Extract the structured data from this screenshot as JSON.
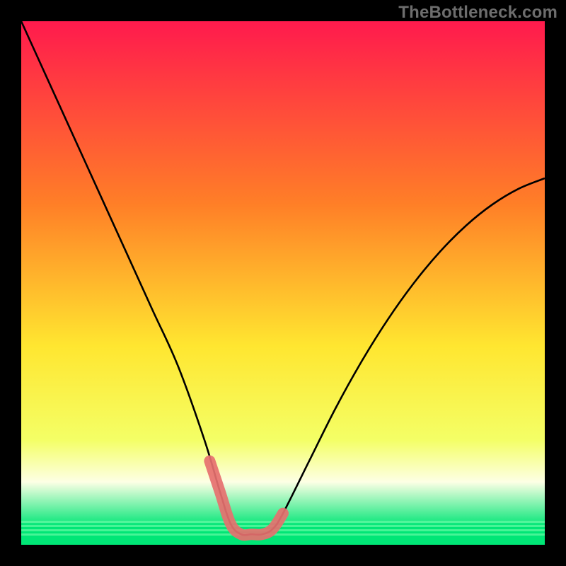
{
  "watermark": "TheBottleneck.com",
  "colors": {
    "frame": "#000000",
    "grad_top": "#ff1a4d",
    "grad_mid_upper": "#ff7f27",
    "grad_mid": "#ffe630",
    "grad_lower": "#f4ff66",
    "grad_bottom_band": "#fdffe5",
    "grad_green": "#00e676",
    "curve": "#000000",
    "pink_overlay": "#e6706f"
  },
  "chart_data": {
    "type": "line",
    "title": "",
    "xlabel": "",
    "ylabel": "",
    "xlim": [
      0,
      100
    ],
    "ylim": [
      0,
      100
    ],
    "series": [
      {
        "name": "bottleneck-curve",
        "x": [
          0,
          5,
          10,
          15,
          20,
          25,
          30,
          35,
          38,
          40,
          42,
          44,
          46,
          48,
          50,
          55,
          60,
          65,
          70,
          75,
          80,
          85,
          90,
          95,
          100
        ],
        "y": [
          100,
          89,
          78,
          67,
          56,
          45,
          34,
          20,
          10,
          4,
          2,
          2,
          2,
          3,
          6,
          16,
          26,
          35,
          43,
          50,
          56,
          61,
          65,
          68,
          70
        ]
      },
      {
        "name": "pink-highlight",
        "x": [
          36,
          38,
          40,
          42,
          44,
          46,
          48,
          50
        ],
        "y": [
          16,
          10,
          4,
          2,
          2,
          2,
          3,
          6
        ]
      }
    ],
    "gradient_stops": [
      {
        "offset": 0.0,
        "color": "#ff1a4d"
      },
      {
        "offset": 0.35,
        "color": "#ff7f27"
      },
      {
        "offset": 0.62,
        "color": "#ffe630"
      },
      {
        "offset": 0.8,
        "color": "#f4ff66"
      },
      {
        "offset": 0.88,
        "color": "#fdffe5"
      },
      {
        "offset": 0.965,
        "color": "#00e676"
      },
      {
        "offset": 1.0,
        "color": "#00e676"
      }
    ]
  }
}
